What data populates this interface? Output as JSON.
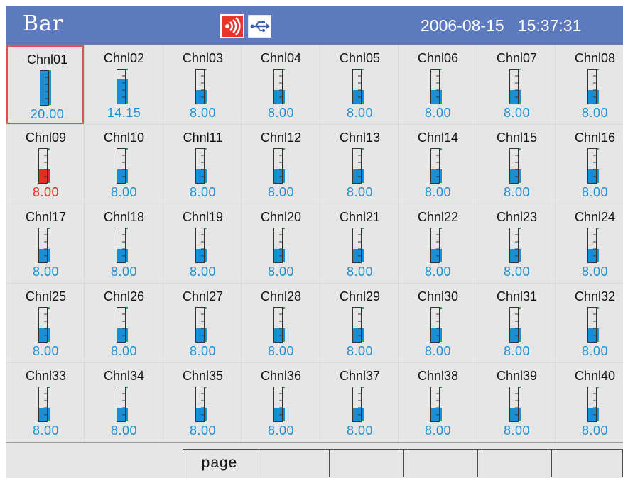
{
  "header": {
    "title": "Bar",
    "date": "2006-08-15",
    "time": "15:37:31",
    "alarm_icon": "alarm-sound-icon",
    "usb_icon": "usb-icon"
  },
  "colors": {
    "header_bg": "#5d7bbc",
    "bar_fill": "#1a8fd6",
    "alarm_fill": "#e03020",
    "value_text": "#1a8fd6",
    "alarm_text": "#e03020",
    "selection_border": "#e05050",
    "tick_marker": "#2fa84f"
  },
  "channels": [
    {
      "label": "Chnl01",
      "value": "20.00",
      "level": 1.0,
      "alarm": false,
      "selected": true
    },
    {
      "label": "Chnl02",
      "value": "14.15",
      "level": 0.71,
      "alarm": false,
      "selected": false
    },
    {
      "label": "Chnl03",
      "value": "8.00",
      "level": 0.4,
      "alarm": false,
      "selected": false
    },
    {
      "label": "Chnl04",
      "value": "8.00",
      "level": 0.4,
      "alarm": false,
      "selected": false
    },
    {
      "label": "Chnl05",
      "value": "8.00",
      "level": 0.4,
      "alarm": false,
      "selected": false
    },
    {
      "label": "Chnl06",
      "value": "8.00",
      "level": 0.4,
      "alarm": false,
      "selected": false
    },
    {
      "label": "Chnl07",
      "value": "8.00",
      "level": 0.4,
      "alarm": false,
      "selected": false
    },
    {
      "label": "Chnl08",
      "value": "8.00",
      "level": 0.4,
      "alarm": false,
      "selected": false
    },
    {
      "label": "Chnl09",
      "value": "8.00",
      "level": 0.4,
      "alarm": true,
      "selected": false
    },
    {
      "label": "Chnl10",
      "value": "8.00",
      "level": 0.4,
      "alarm": false,
      "selected": false
    },
    {
      "label": "Chnl11",
      "value": "8.00",
      "level": 0.4,
      "alarm": false,
      "selected": false
    },
    {
      "label": "Chnl12",
      "value": "8.00",
      "level": 0.4,
      "alarm": false,
      "selected": false
    },
    {
      "label": "Chnl13",
      "value": "8.00",
      "level": 0.4,
      "alarm": false,
      "selected": false
    },
    {
      "label": "Chnl14",
      "value": "8.00",
      "level": 0.4,
      "alarm": false,
      "selected": false
    },
    {
      "label": "Chnl15",
      "value": "8.00",
      "level": 0.4,
      "alarm": false,
      "selected": false
    },
    {
      "label": "Chnl16",
      "value": "8.00",
      "level": 0.4,
      "alarm": false,
      "selected": false
    },
    {
      "label": "Chnl17",
      "value": "8.00",
      "level": 0.4,
      "alarm": false,
      "selected": false
    },
    {
      "label": "Chnl18",
      "value": "8.00",
      "level": 0.4,
      "alarm": false,
      "selected": false
    },
    {
      "label": "Chnl19",
      "value": "8.00",
      "level": 0.4,
      "alarm": false,
      "selected": false
    },
    {
      "label": "Chnl20",
      "value": "8.00",
      "level": 0.4,
      "alarm": false,
      "selected": false
    },
    {
      "label": "Chnl21",
      "value": "8.00",
      "level": 0.4,
      "alarm": false,
      "selected": false
    },
    {
      "label": "Chnl22",
      "value": "8.00",
      "level": 0.4,
      "alarm": false,
      "selected": false
    },
    {
      "label": "Chnl23",
      "value": "8.00",
      "level": 0.4,
      "alarm": false,
      "selected": false
    },
    {
      "label": "Chnl24",
      "value": "8.00",
      "level": 0.4,
      "alarm": false,
      "selected": false
    },
    {
      "label": "Chnl25",
      "value": "8.00",
      "level": 0.4,
      "alarm": false,
      "selected": false
    },
    {
      "label": "Chnl26",
      "value": "8.00",
      "level": 0.4,
      "alarm": false,
      "selected": false
    },
    {
      "label": "Chnl27",
      "value": "8.00",
      "level": 0.4,
      "alarm": false,
      "selected": false
    },
    {
      "label": "Chnl28",
      "value": "8.00",
      "level": 0.4,
      "alarm": false,
      "selected": false
    },
    {
      "label": "Chnl29",
      "value": "8.00",
      "level": 0.4,
      "alarm": false,
      "selected": false
    },
    {
      "label": "Chnl30",
      "value": "8.00",
      "level": 0.4,
      "alarm": false,
      "selected": false
    },
    {
      "label": "Chnl31",
      "value": "8.00",
      "level": 0.4,
      "alarm": false,
      "selected": false
    },
    {
      "label": "Chnl32",
      "value": "8.00",
      "level": 0.4,
      "alarm": false,
      "selected": false
    },
    {
      "label": "Chnl33",
      "value": "8.00",
      "level": 0.4,
      "alarm": false,
      "selected": false
    },
    {
      "label": "Chnl34",
      "value": "8.00",
      "level": 0.4,
      "alarm": false,
      "selected": false
    },
    {
      "label": "Chnl35",
      "value": "8.00",
      "level": 0.4,
      "alarm": false,
      "selected": false
    },
    {
      "label": "Chnl36",
      "value": "8.00",
      "level": 0.4,
      "alarm": false,
      "selected": false
    },
    {
      "label": "Chnl37",
      "value": "8.00",
      "level": 0.4,
      "alarm": false,
      "selected": false
    },
    {
      "label": "Chnl38",
      "value": "8.00",
      "level": 0.4,
      "alarm": false,
      "selected": false
    },
    {
      "label": "Chnl39",
      "value": "8.00",
      "level": 0.4,
      "alarm": false,
      "selected": false
    },
    {
      "label": "Chnl40",
      "value": "8.00",
      "level": 0.4,
      "alarm": false,
      "selected": false
    }
  ],
  "footer": {
    "softkeys": [
      "page",
      "",
      "",
      "",
      "",
      ""
    ]
  }
}
